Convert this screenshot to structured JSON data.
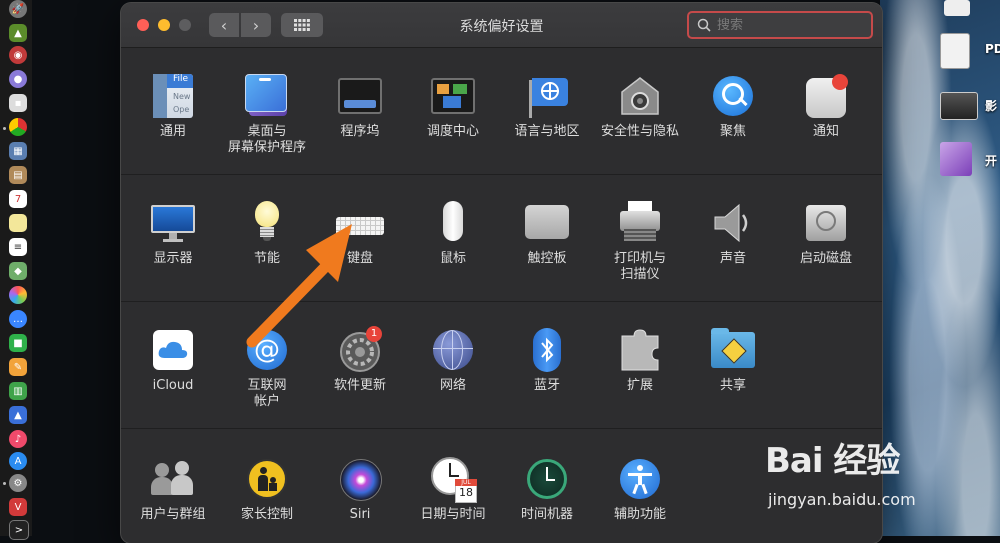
{
  "window": {
    "title": "系统偏好设置",
    "back_glyph": "‹",
    "forward_glyph": "›"
  },
  "search": {
    "placeholder": "搜索",
    "value": ""
  },
  "sections": [
    {
      "items": [
        {
          "label": "通用",
          "icon": "general-icon"
        },
        {
          "label": "桌面与\n屏幕保护程序",
          "icon": "desktop-screensaver-icon"
        },
        {
          "label": "程序坞",
          "icon": "dock-icon"
        },
        {
          "label": "调度中心",
          "icon": "mission-control-icon"
        },
        {
          "label": "语言与地区",
          "icon": "language-region-icon"
        },
        {
          "label": "安全性与隐私",
          "icon": "security-privacy-icon"
        },
        {
          "label": "聚焦",
          "icon": "spotlight-icon"
        },
        {
          "label": "通知",
          "icon": "notifications-icon"
        }
      ]
    },
    {
      "items": [
        {
          "label": "显示器",
          "icon": "displays-icon"
        },
        {
          "label": "节能",
          "icon": "energy-saver-icon"
        },
        {
          "label": "键盘",
          "icon": "keyboard-icon"
        },
        {
          "label": "鼠标",
          "icon": "mouse-icon"
        },
        {
          "label": "触控板",
          "icon": "trackpad-icon"
        },
        {
          "label": "打印机与\n扫描仪",
          "icon": "printers-scanners-icon"
        },
        {
          "label": "声音",
          "icon": "sound-icon"
        },
        {
          "label": "启动磁盘",
          "icon": "startup-disk-icon"
        }
      ]
    },
    {
      "items": [
        {
          "label": "iCloud",
          "icon": "icloud-icon"
        },
        {
          "label": "互联网\n帐户",
          "icon": "internet-accounts-icon"
        },
        {
          "label": "软件更新",
          "icon": "software-update-icon",
          "badge": "1"
        },
        {
          "label": "网络",
          "icon": "network-icon"
        },
        {
          "label": "蓝牙",
          "icon": "bluetooth-icon"
        },
        {
          "label": "扩展",
          "icon": "extensions-icon"
        },
        {
          "label": "共享",
          "icon": "sharing-icon"
        }
      ]
    },
    {
      "items": [
        {
          "label": "用户与群组",
          "icon": "users-groups-icon"
        },
        {
          "label": "家长控制",
          "icon": "parental-controls-icon"
        },
        {
          "label": "Siri",
          "icon": "siri-icon"
        },
        {
          "label": "日期与时间",
          "icon": "date-time-icon",
          "calendar_month": "JUL",
          "calendar_day": "18"
        },
        {
          "label": "时间机器",
          "icon": "time-machine-icon"
        },
        {
          "label": "辅助功能",
          "icon": "accessibility-icon"
        }
      ]
    }
  ],
  "general_icon_text": [
    "File",
    "New",
    "Ope"
  ],
  "desktop": [
    {
      "label": "PD",
      "icon": "document-file-icon"
    },
    {
      "label": "影",
      "icon": "video-file-icon"
    },
    {
      "label": "开",
      "icon": "purple-app-file-icon"
    }
  ],
  "watermark": {
    "brand": "Bai 经验",
    "url": "jingyan.baidu.com"
  },
  "colors": {
    "window_bg": "#2d2d2f",
    "arrow": "#f07a1e",
    "search_focus": "#c54a4a"
  }
}
